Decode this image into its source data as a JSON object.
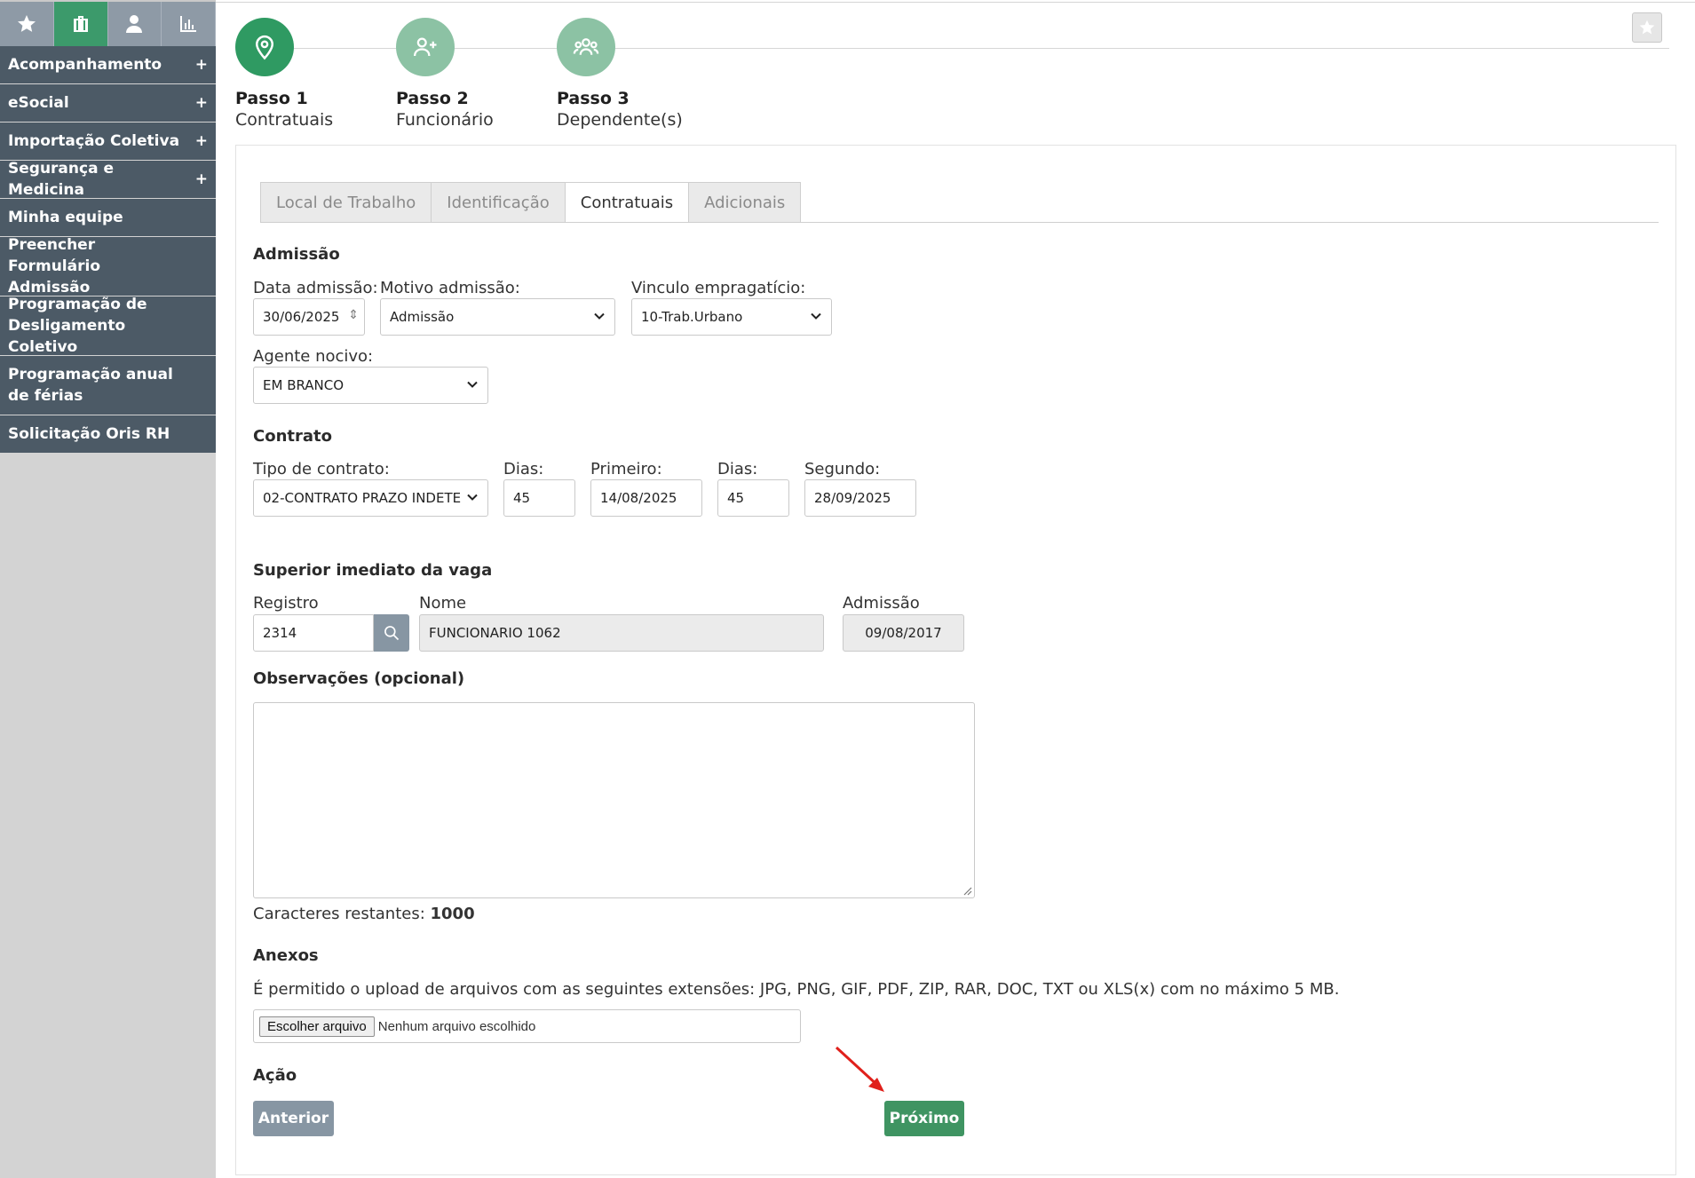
{
  "sidebar": {
    "items": [
      {
        "label": "Acompanhamento",
        "plus": "+"
      },
      {
        "label": "eSocial",
        "plus": "+"
      },
      {
        "label": "Importação Coletiva",
        "plus": "+"
      },
      {
        "label": "Segurança e Medicina",
        "plus": "+"
      },
      {
        "label": "Minha equipe"
      },
      {
        "label": "Preencher Formulário Admissão"
      },
      {
        "label": "Programação de Desligamento Coletivo"
      },
      {
        "label": "Programação anual de férias"
      },
      {
        "label": "Solicitação Oris RH"
      }
    ]
  },
  "steps": [
    {
      "title": "Passo 1",
      "sub": "Contratuais"
    },
    {
      "title": "Passo 2",
      "sub": "Funcionário"
    },
    {
      "title": "Passo 3",
      "sub": "Dependente(s)"
    }
  ],
  "tabs": [
    "Local de Trabalho",
    "Identificação",
    "Contratuais",
    "Adicionais"
  ],
  "admissao": {
    "title": "Admissão",
    "data_label": "Data admissão:",
    "data_value": "30/06/2025",
    "motivo_label": "Motivo admissão:",
    "motivo_value": "Admissão",
    "vinculo_label": "Vinculo empragatício:",
    "vinculo_value": "10-Trab.Urbano",
    "agente_label": "Agente nocivo:",
    "agente_value": "EM BRANCO"
  },
  "contrato": {
    "title": "Contrato",
    "tipo_label": "Tipo de contrato:",
    "tipo_value": "02-CONTRATO PRAZO INDETE",
    "dias1_label": "Dias:",
    "dias1_value": "45",
    "primeiro_label": "Primeiro:",
    "primeiro_value": "14/08/2025",
    "dias2_label": "Dias:",
    "dias2_value": "45",
    "segundo_label": "Segundo:",
    "segundo_value": "28/09/2025"
  },
  "superior": {
    "title": "Superior imediato da vaga",
    "registro_label": "Registro",
    "registro_value": "2314",
    "nome_label": "Nome",
    "nome_value": "FUNCIONARIO 1062",
    "admissao_label": "Admissão",
    "admissao_value": "09/08/2017"
  },
  "observacoes": {
    "title": "Observações (opcional)",
    "remaining_label": "Caracteres restantes:",
    "remaining_value": "1000"
  },
  "anexos": {
    "title": "Anexos",
    "info": "É permitido o upload de arquivos com as seguintes extensões: JPG, PNG, GIF, PDF, ZIP, RAR, DOC, TXT ou XLS(x) com no máximo 5 MB.",
    "file_button": "Escolher arquivo",
    "file_status": "Nenhum arquivo escolhido"
  },
  "acao": {
    "title": "Ação",
    "prev_label": "Anterior",
    "next_label": "Próximo"
  },
  "colors": {
    "accent_green": "#3f9462",
    "sidebar_dark": "#4c5a66",
    "arrow": "#e0201b"
  }
}
